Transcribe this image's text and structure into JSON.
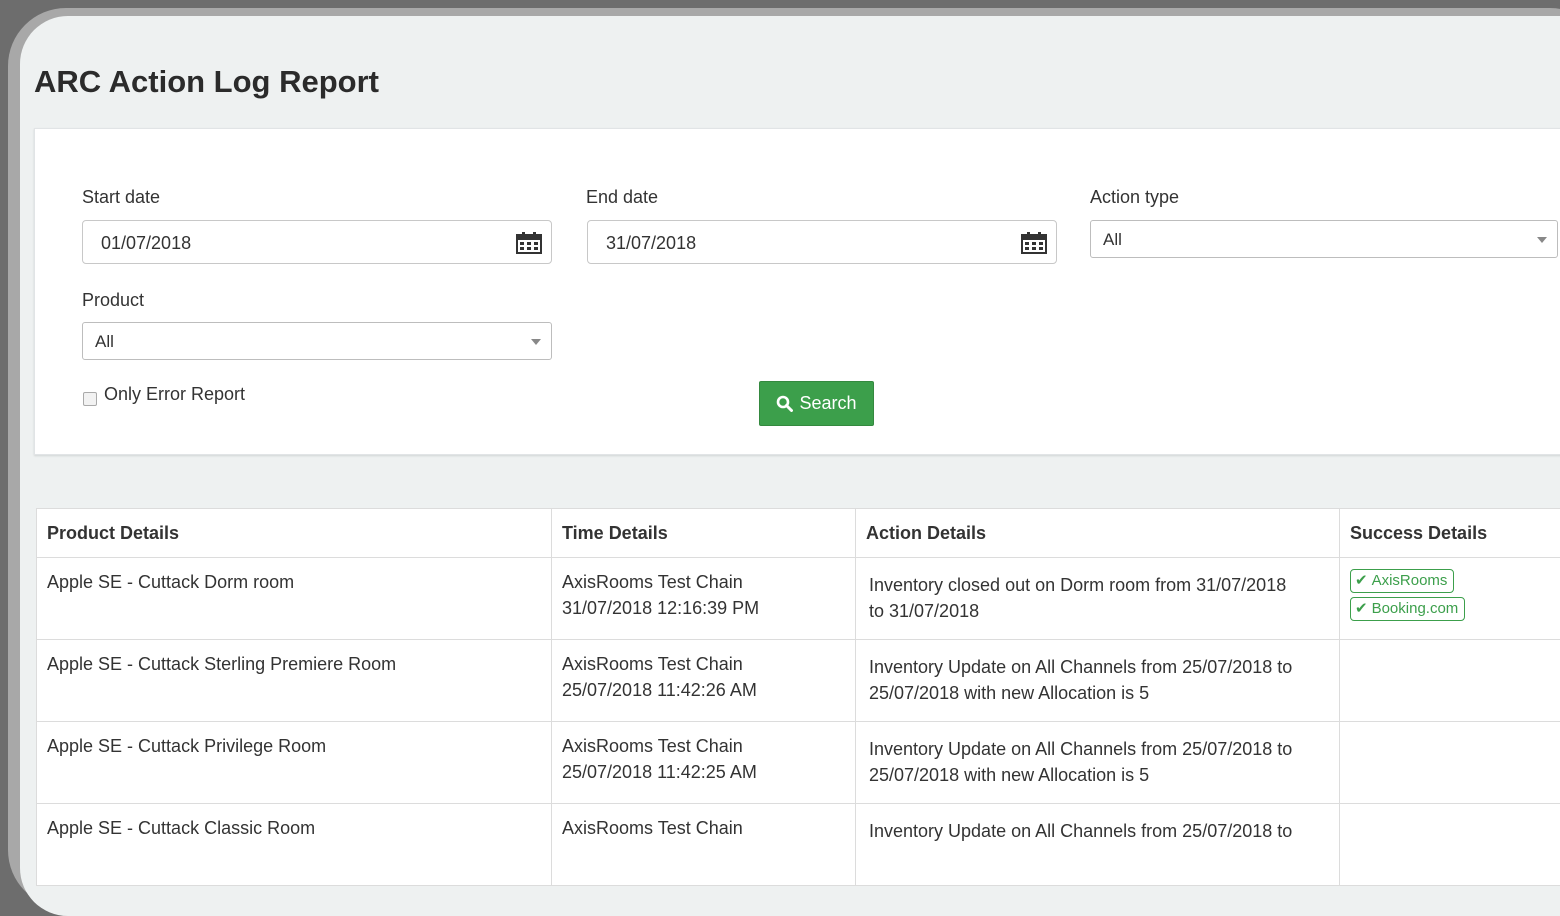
{
  "page": {
    "title": "ARC Action Log Report"
  },
  "filters": {
    "start_date_label": "Start date",
    "start_date_value": "01/07/2018",
    "end_date_label": "End date",
    "end_date_value": "31/07/2018",
    "action_type_label": "Action type",
    "action_type_value": "All",
    "product_label": "Product",
    "product_value": "All",
    "only_error_label": "Only Error Report",
    "search_label": "Search"
  },
  "table": {
    "headers": [
      "Product Details",
      "Time Details",
      "Action Details",
      "Success Details"
    ],
    "rows": [
      {
        "product": "Apple SE - Cuttack Dorm room",
        "time_chain": "AxisRooms Test Chain",
        "time_stamp": "31/07/2018 12:16:39 PM",
        "action_line1": "Inventory closed out on Dorm room from 31/07/2018",
        "action_line2": "to 31/07/2018",
        "success": [
          "AxisRooms",
          "Booking.com"
        ]
      },
      {
        "product": "Apple SE - Cuttack Sterling Premiere Room",
        "time_chain": "AxisRooms Test Chain",
        "time_stamp": "25/07/2018 11:42:26 AM",
        "action_line1": "Inventory Update on All Channels from 25/07/2018 to",
        "action_line2": "25/07/2018 with new Allocation is 5",
        "success": []
      },
      {
        "product": "Apple SE - Cuttack Privilege Room",
        "time_chain": "AxisRooms Test Chain",
        "time_stamp": "25/07/2018 11:42:25 AM",
        "action_line1": "Inventory Update on All Channels from 25/07/2018 to",
        "action_line2": "25/07/2018 with new Allocation is 5",
        "success": []
      },
      {
        "product": "Apple SE - Cuttack Classic Room",
        "time_chain": "AxisRooms Test Chain",
        "time_stamp": "",
        "action_line1": "Inventory Update on All Channels from 25/07/2018 to",
        "action_line2": "",
        "success": []
      }
    ]
  },
  "colors": {
    "accent_green": "#3c9f4b",
    "background": "#eef1f1"
  }
}
